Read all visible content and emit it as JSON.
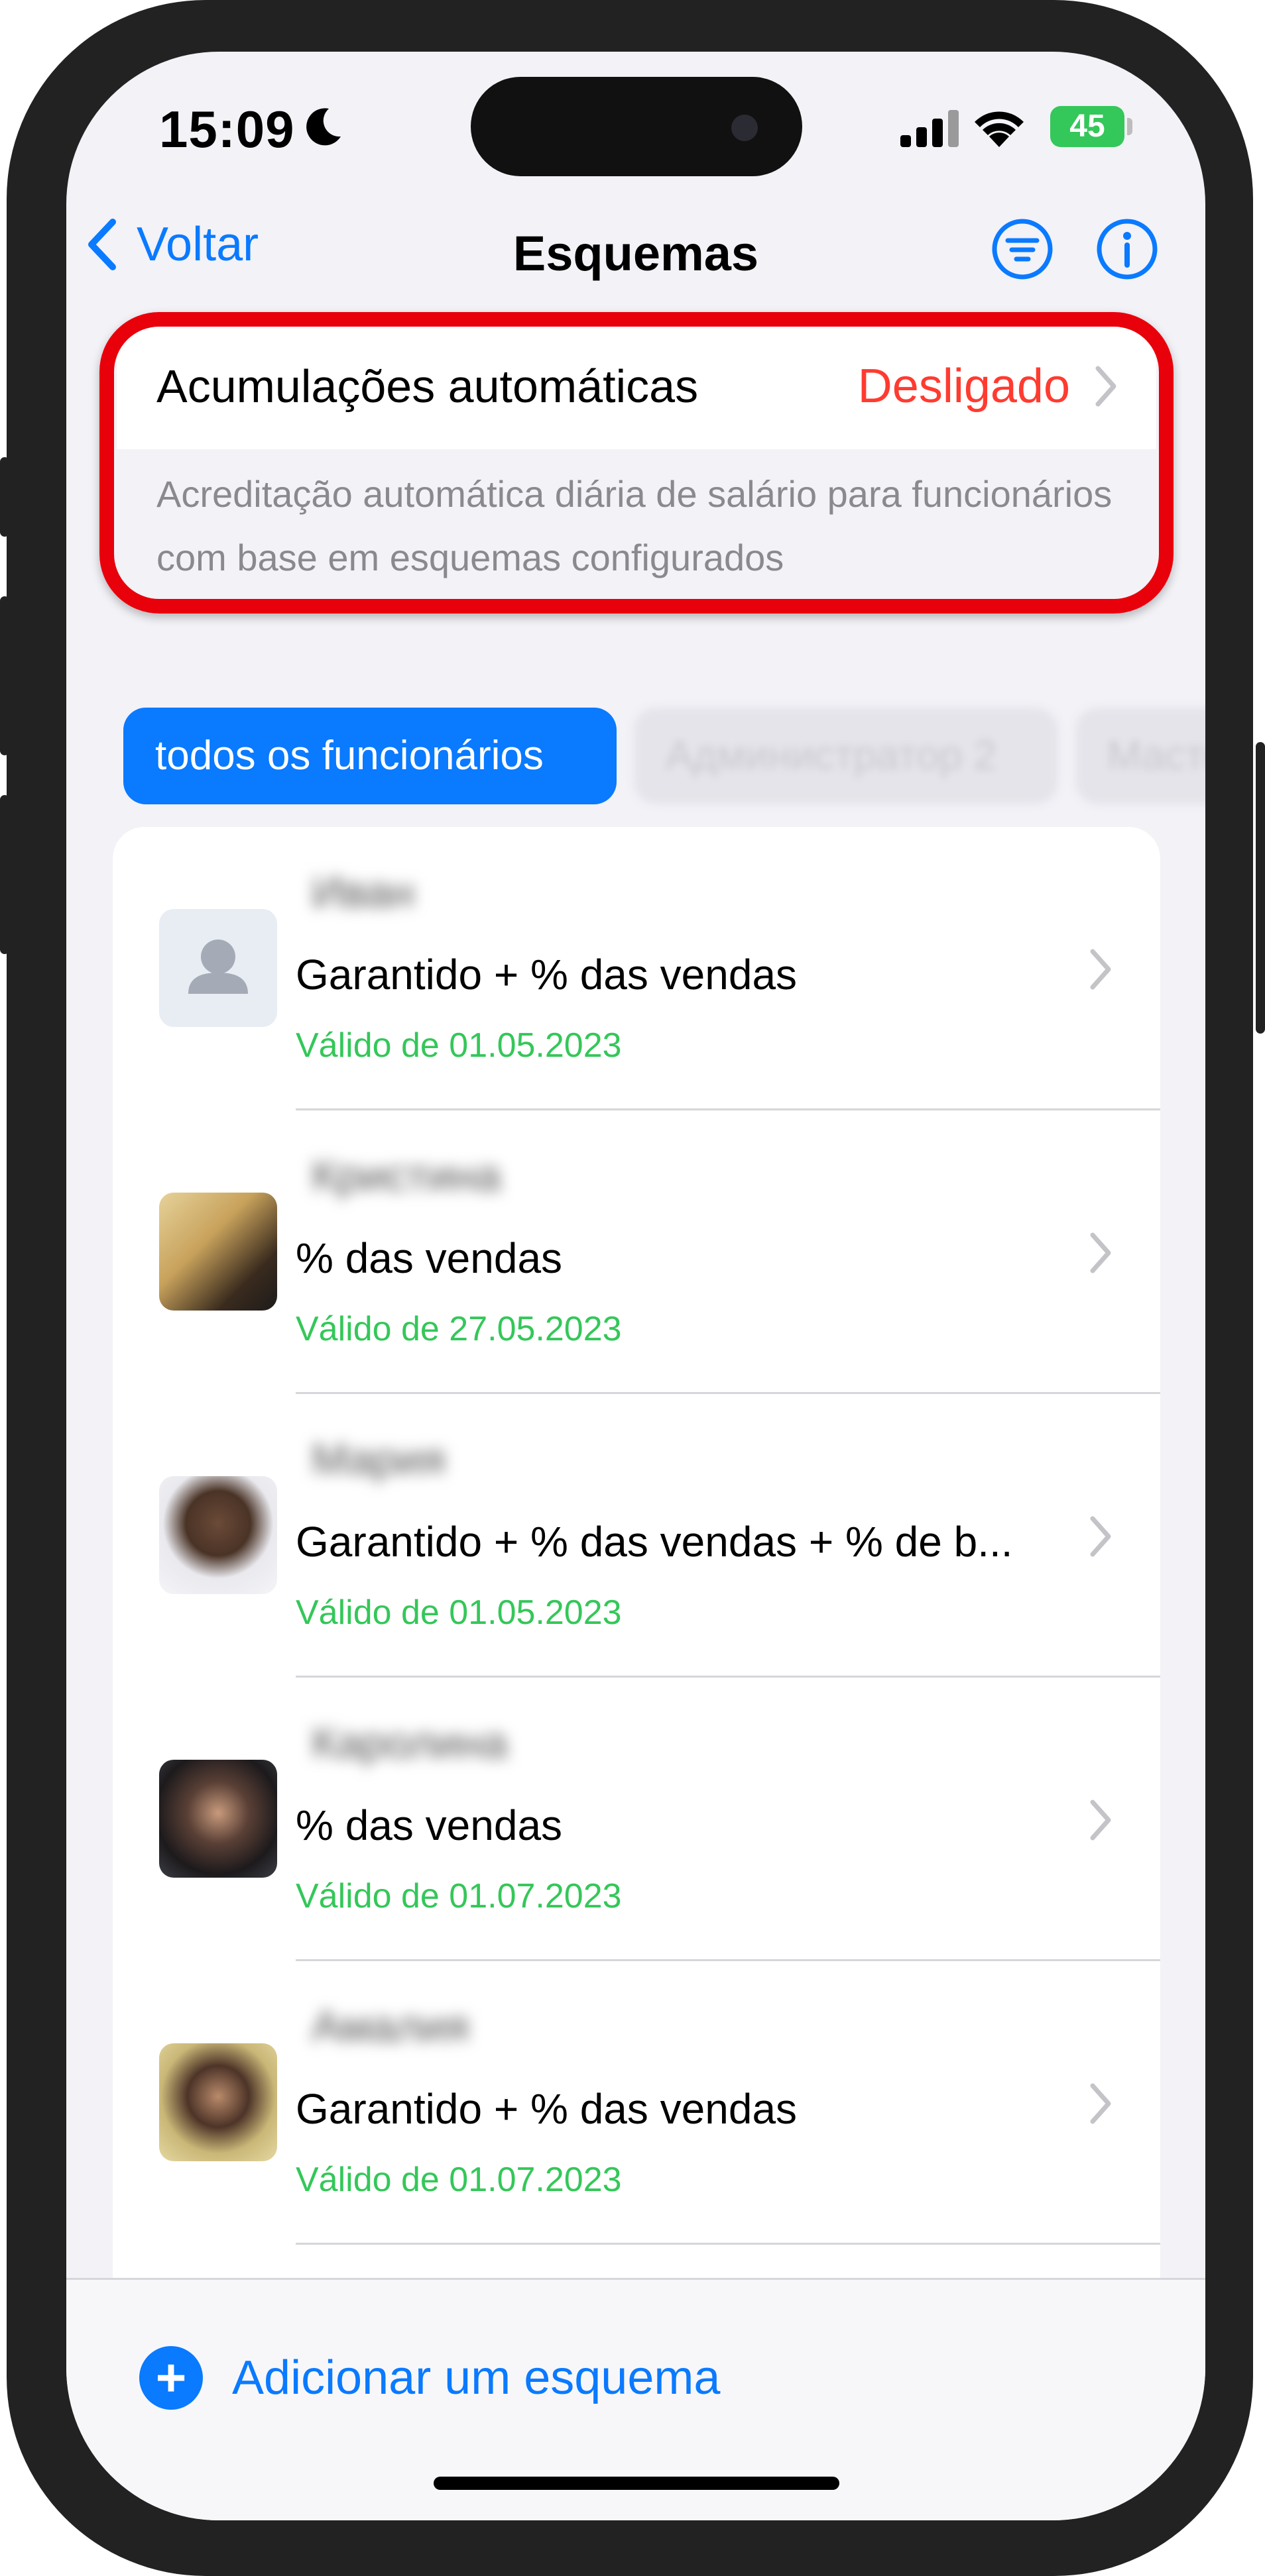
{
  "status": {
    "time": "15:09",
    "battery": "45"
  },
  "nav": {
    "back_label": "Voltar",
    "title": "Esquemas"
  },
  "auto_accrual": {
    "label": "Acumulações automáticas",
    "value": "Desligado",
    "description": "Acreditação automática diária de salário para funcionários com base em esquemas configurados"
  },
  "filters": [
    {
      "label": "todos os funcionários",
      "active": true
    },
    {
      "label": "Администратор 2",
      "active": false
    },
    {
      "label": "Мастер",
      "active": false
    }
  ],
  "employees": [
    {
      "name": "Иван",
      "scheme": "Garantido + % das vendas",
      "valid": "Válido de 01.05.2023",
      "avatar": "placeholder"
    },
    {
      "name": "Кристина",
      "scheme": "% das vendas",
      "valid": "Válido de 27.05.2023",
      "avatar": "photo"
    },
    {
      "name": "Мария",
      "scheme": "Garantido + % das vendas + % de b...",
      "valid": "Válido de 01.05.2023",
      "avatar": "photo"
    },
    {
      "name": "Каролина",
      "scheme": "% das vendas",
      "valid": "Válido de 01.07.2023",
      "avatar": "photo"
    },
    {
      "name": "Амалия",
      "scheme": "Garantido + % das vendas",
      "valid": "Válido de 01.07.2023",
      "avatar": "photo"
    }
  ],
  "bottom": {
    "add_label": "Adicionar um esquema"
  },
  "colors": {
    "accent": "#0a7aff",
    "danger": "#ff3b30",
    "success": "#34c759",
    "highlight": "#e8000b"
  }
}
